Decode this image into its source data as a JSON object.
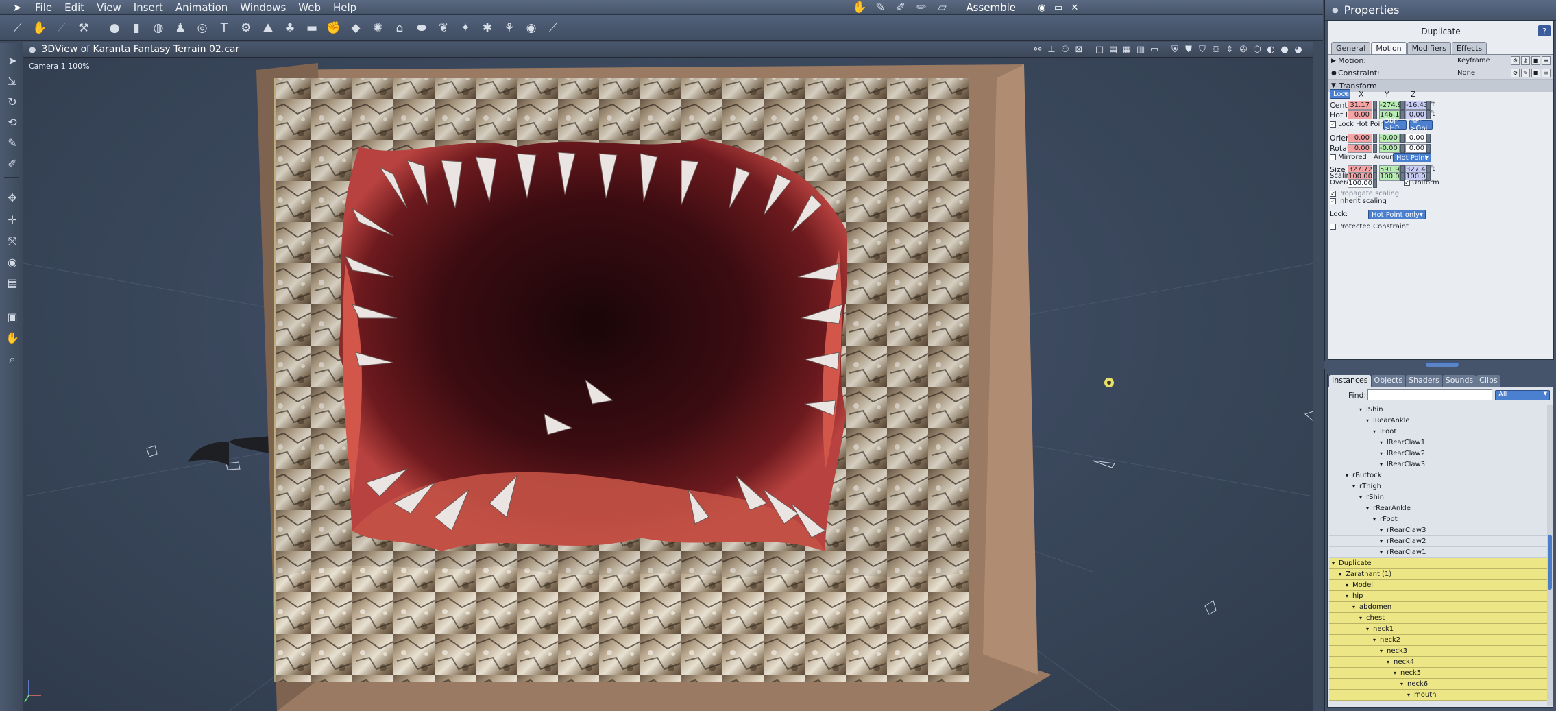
{
  "menubar": {
    "items": [
      "File",
      "Edit",
      "View",
      "Insert",
      "Animation",
      "Windows",
      "Web",
      "Help"
    ],
    "room_title": "Assemble"
  },
  "viewport": {
    "title": "3DView of Karanta Fantasy Terrain 02.car",
    "camera_label": "Camera 1 100%"
  },
  "properties": {
    "title": "Properties",
    "object_name": "Duplicate",
    "tabs": [
      "General",
      "Motion",
      "Modifiers",
      "Effects"
    ],
    "motion": {
      "label": "Motion:",
      "value": "Keyframe"
    },
    "constraint": {
      "label": "Constraint:",
      "value": "None"
    },
    "transform": {
      "label": "Transform",
      "space": "Local",
      "axes": [
        "X",
        "Y",
        "Z"
      ],
      "center": {
        "label": "Center",
        "x": "31.17",
        "y": "-274.92",
        "z": "-16.43",
        "unit": "ft"
      },
      "hot_point": {
        "label": "Hot Pt.",
        "x": "0.00",
        "y": "146.18",
        "z": "0.00",
        "unit": "ft"
      },
      "lock_hot_point": "Lock Hot Point",
      "obj_hp": "Obj->HP",
      "hp_obj": "HP->Obj",
      "orient": {
        "label": "Orient.",
        "x": "0.00",
        "y": "-0.00",
        "z": "0.00"
      },
      "rotation": {
        "label": "Rotation",
        "x": "0.00",
        "y": "-0.00",
        "z": "0.00"
      },
      "mirrored": "Mirrored",
      "around_label": "Around",
      "around_value": "Hot Point",
      "size": {
        "label": "Size",
        "x": "327.72",
        "y": "591.94",
        "z": "327.43",
        "unit": "ft"
      },
      "scaling": {
        "label": "Scaling",
        "x": "100.00",
        "y": "100.00",
        "z": "100.00"
      },
      "overall": {
        "label": "Overall",
        "value": "100.00"
      },
      "uniform": "Uniform",
      "propagate_scaling": "Propagate scaling",
      "inherit_scaling": "Inherit scaling",
      "lock_label": "Lock:",
      "lock_value": "Hot Point only",
      "protected_constraint": "Protected Constraint"
    }
  },
  "library": {
    "tabs": [
      "Instances",
      "Objects",
      "Shaders",
      "Sounds",
      "Clips"
    ],
    "find_label": "Find:",
    "find_value": "",
    "filter": "All",
    "tree": [
      {
        "label": "lShin",
        "indent": 4,
        "sel": false
      },
      {
        "label": "lRearAnkle",
        "indent": 5,
        "sel": false
      },
      {
        "label": "lFoot",
        "indent": 6,
        "sel": false
      },
      {
        "label": "lRearClaw1",
        "indent": 7,
        "sel": false
      },
      {
        "label": "lRearClaw2",
        "indent": 7,
        "sel": false
      },
      {
        "label": "lRearClaw3",
        "indent": 7,
        "sel": false
      },
      {
        "label": "rButtock",
        "indent": 2,
        "sel": false
      },
      {
        "label": "rThigh",
        "indent": 3,
        "sel": false
      },
      {
        "label": "rShin",
        "indent": 4,
        "sel": false
      },
      {
        "label": "rRearAnkle",
        "indent": 5,
        "sel": false
      },
      {
        "label": "rFoot",
        "indent": 6,
        "sel": false
      },
      {
        "label": "rRearClaw3",
        "indent": 7,
        "sel": false
      },
      {
        "label": "rRearClaw2",
        "indent": 7,
        "sel": false
      },
      {
        "label": "rRearClaw1",
        "indent": 7,
        "sel": false
      },
      {
        "label": "Duplicate",
        "indent": 0,
        "sel": true
      },
      {
        "label": "Zarathant (1)",
        "indent": 1,
        "sel": true
      },
      {
        "label": "Model",
        "indent": 2,
        "sel": true
      },
      {
        "label": "hip",
        "indent": 2,
        "sel": true
      },
      {
        "label": "abdomen",
        "indent": 3,
        "sel": true
      },
      {
        "label": "chest",
        "indent": 4,
        "sel": true
      },
      {
        "label": "neck1",
        "indent": 5,
        "sel": true
      },
      {
        "label": "neck2",
        "indent": 6,
        "sel": true
      },
      {
        "label": "neck3",
        "indent": 7,
        "sel": true
      },
      {
        "label": "neck4",
        "indent": 8,
        "sel": true
      },
      {
        "label": "neck5",
        "indent": 9,
        "sel": true
      },
      {
        "label": "neck6",
        "indent": 10,
        "sel": true
      },
      {
        "label": "mouth",
        "indent": 11,
        "sel": true
      }
    ]
  },
  "colors": {
    "accent": "#4b7fd0",
    "selection": "#ece686",
    "x_field": "#f5a4a4",
    "y_field": "#b9ecb2",
    "z_field": "#c9cdf4"
  }
}
